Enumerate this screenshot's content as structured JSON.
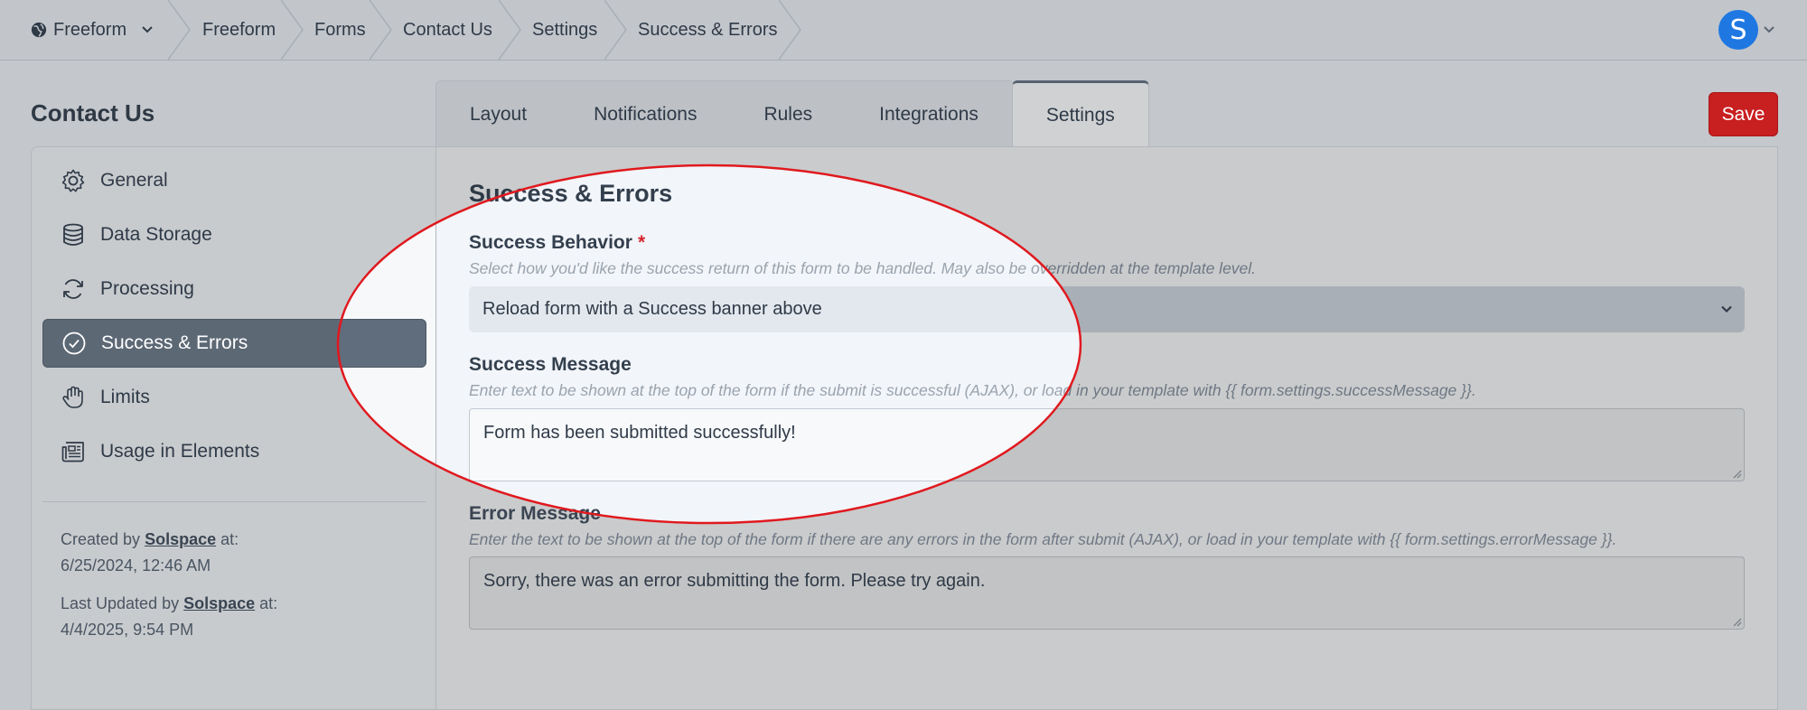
{
  "breadcrumbs": [
    {
      "label": "Freeform",
      "icon": "globe-icon",
      "has_dropdown": true
    },
    {
      "label": "Freeform"
    },
    {
      "label": "Forms"
    },
    {
      "label": "Contact Us"
    },
    {
      "label": "Settings"
    },
    {
      "label": "Success & Errors"
    }
  ],
  "user": {
    "avatar_letter": "S"
  },
  "page": {
    "title": "Contact Us"
  },
  "tabs": [
    {
      "label": "Layout",
      "active": false
    },
    {
      "label": "Notifications",
      "active": false
    },
    {
      "label": "Rules",
      "active": false
    },
    {
      "label": "Integrations",
      "active": false
    },
    {
      "label": "Settings",
      "active": true
    }
  ],
  "save_label": "Save",
  "sidebar": {
    "items": [
      {
        "label": "General",
        "icon": "gear-icon",
        "active": false
      },
      {
        "label": "Data Storage",
        "icon": "database-icon",
        "active": false
      },
      {
        "label": "Processing",
        "icon": "refresh-icon",
        "active": false
      },
      {
        "label": "Success & Errors",
        "icon": "check-circle-icon",
        "active": true
      },
      {
        "label": "Limits",
        "icon": "hand-icon",
        "active": false
      },
      {
        "label": "Usage in Elements",
        "icon": "newspaper-icon",
        "active": false
      }
    ],
    "created": {
      "prefix": "Created by",
      "who": "Solspace",
      "suffix": "at:",
      "date": "6/25/2024, 12:46 AM"
    },
    "updated": {
      "prefix": "Last Updated by",
      "who": "Solspace",
      "suffix": "at:",
      "date": "4/4/2025, 9:54 PM"
    }
  },
  "section": {
    "title": "Success & Errors",
    "success_behavior": {
      "label": "Success Behavior",
      "required_mark": "*",
      "help": "Select how you'd like the success return of this form to be handled. May also be overridden at the template level.",
      "value": "Reload form with a Success banner above"
    },
    "success_message": {
      "label": "Success Message",
      "help": "Enter text to be shown at the top of the form if the submit is successful (AJAX), or load in your template with {{ form.settings.successMessage }}.",
      "value": "Form has been submitted successfully!"
    },
    "error_message": {
      "label": "Error Message",
      "help": "Enter the text to be shown at the top of the form if there are any errors in the form after submit (AJAX), or load in your template with {{ form.settings.errorMessage }}.",
      "value": "Sorry, there was an error submitting the form. Please try again."
    }
  },
  "colors": {
    "highlight_ring": "#e0191e",
    "save_button": "#c81f21",
    "active_sidebar": "#5d6875",
    "avatar": "#1f78e2"
  }
}
